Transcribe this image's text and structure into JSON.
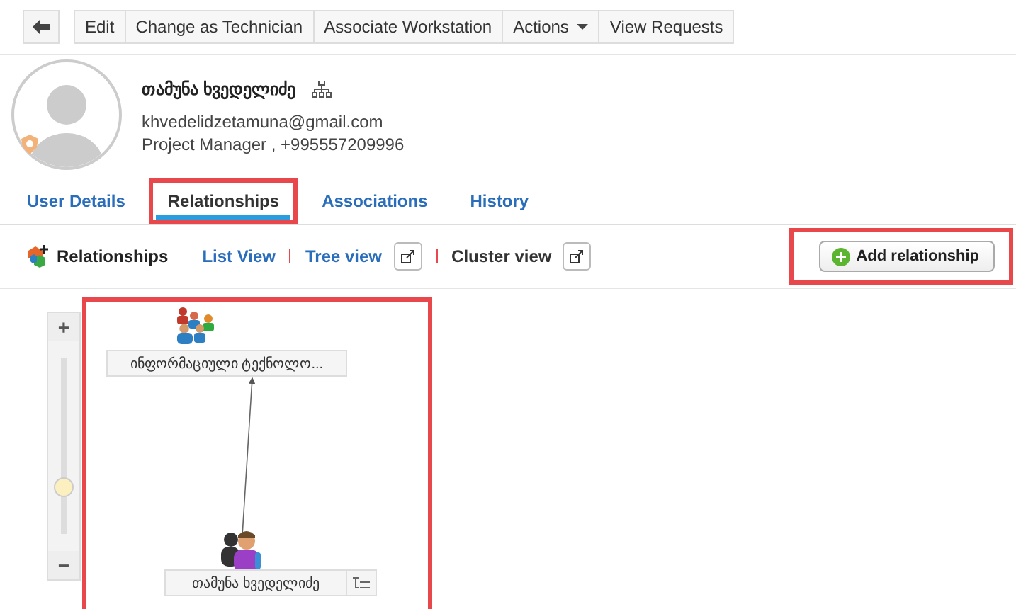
{
  "toolbar": {
    "buttons": [
      {
        "label": "Edit",
        "kind": "plain"
      },
      {
        "label": "Change as Technician",
        "kind": "plain"
      },
      {
        "label": "Associate Workstation",
        "kind": "plain"
      },
      {
        "label": "Actions",
        "kind": "dropdown"
      },
      {
        "label": "View Requests",
        "kind": "plain"
      }
    ]
  },
  "profile": {
    "name": "თამუნა ხვედელიძე",
    "email": "khvedelidzetamuna@gmail.com",
    "details": "Project Manager , +995557209996"
  },
  "tabs": [
    {
      "label": "User Details",
      "selected": false,
      "highlighted": false
    },
    {
      "label": "Relationships",
      "selected": true,
      "highlighted": true
    },
    {
      "label": "Associations",
      "selected": false,
      "highlighted": false
    },
    {
      "label": "History",
      "selected": false,
      "highlighted": false
    }
  ],
  "relations_bar": {
    "title": "Relationships",
    "views": [
      {
        "label": "List View",
        "selected": false,
        "popout": false
      },
      {
        "label": "Tree view",
        "selected": false,
        "popout": true
      },
      {
        "label": "Cluster view",
        "selected": true,
        "popout": true
      }
    ],
    "add_button": {
      "label": "Add relationship",
      "highlighted": true
    }
  },
  "zoom": {
    "plus": "+",
    "minus": "−",
    "level": 0.27
  },
  "diagram": {
    "highlighted": true,
    "nodes": [
      {
        "label": "ინფორმაციული ტექნოლო...",
        "kind": "group"
      },
      {
        "label": "თამუნა ხვედელიძე",
        "kind": "user"
      }
    ]
  }
}
